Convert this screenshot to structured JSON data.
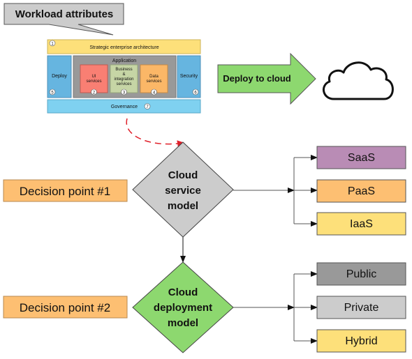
{
  "callout": {
    "title": "Workload attributes"
  },
  "architecture": {
    "strategic": {
      "label": "Strategic enterprise architecture",
      "num": "1"
    },
    "application": {
      "label": "Application"
    },
    "ui": {
      "line1": "UI",
      "line2": "services",
      "num": "2"
    },
    "business": {
      "line1": "Business",
      "line2": "&",
      "line3": "integration",
      "line4": "services",
      "num": "3"
    },
    "data": {
      "line1": "Data",
      "line2": "services",
      "num": "4"
    },
    "deploy": {
      "label": "Deploy",
      "num": "5"
    },
    "security": {
      "label": "Security",
      "num": "6"
    },
    "governance": {
      "label": "Governance",
      "num": "7"
    }
  },
  "deploy_arrow": {
    "label": "Deploy to cloud"
  },
  "decision1": {
    "label": "Decision point #1",
    "diamond": [
      "Cloud",
      "service",
      "model"
    ],
    "options": [
      {
        "label": "SaaS",
        "color": "#b98cb5"
      },
      {
        "label": "PaaS",
        "color": "#fdbf72"
      },
      {
        "label": "IaaS",
        "color": "#fde07a"
      }
    ]
  },
  "decision2": {
    "label": "Decision point #2",
    "diamond": [
      "Cloud",
      "deployment",
      "model"
    ],
    "options": [
      {
        "label": "Public",
        "color": "#999999"
      },
      {
        "label": "Private",
        "color": "#cccccc"
      },
      {
        "label": "Hybrid",
        "color": "#fde07a"
      }
    ]
  },
  "colors": {
    "orange": "#fdbf72",
    "green": "#8dd86f",
    "gray": "#cccccc",
    "blue": "#66b5e0",
    "light_blue": "#7fd1f0",
    "red": "#e0202a"
  }
}
